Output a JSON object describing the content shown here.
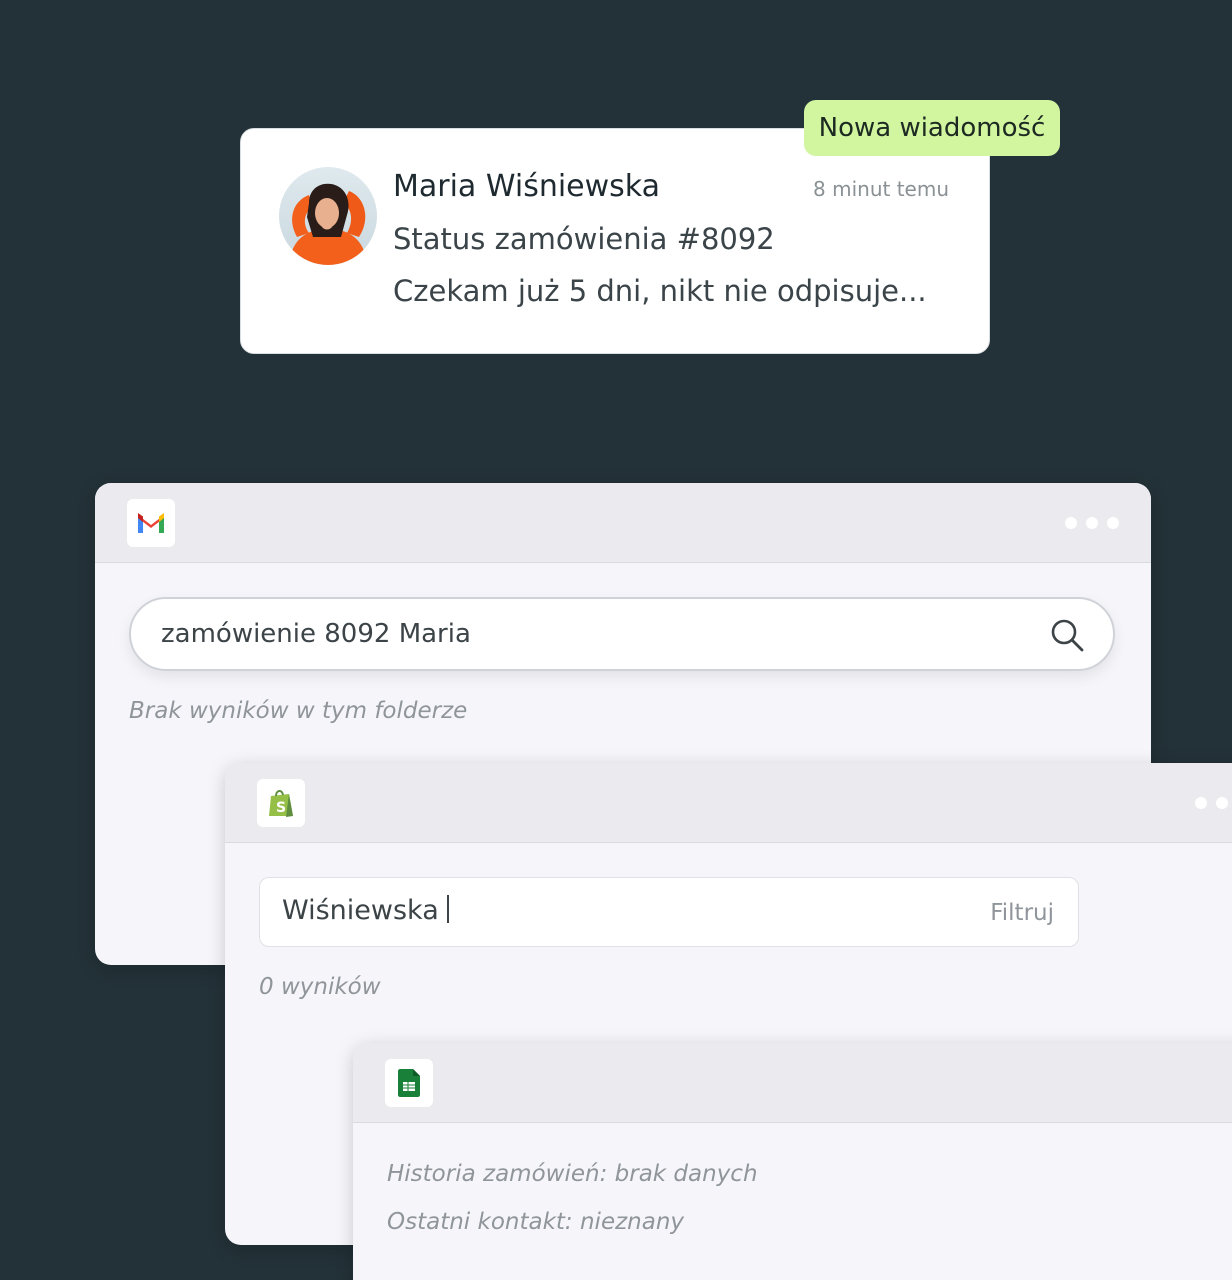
{
  "notification": {
    "badge": "Nowa wiadomość",
    "sender": "Maria Wiśniewska",
    "time": "8 minut temu",
    "subject": "Status zamówienia #8092",
    "preview": "Czekam już 5 dni, nikt nie odpisuje..."
  },
  "gmail": {
    "icon": "gmail-icon",
    "search_value": "zamówienie 8092 Maria",
    "no_results": "Brak wyników w tym folderze"
  },
  "shopify": {
    "icon": "shopify-icon",
    "filter_value": "Wiśniewska",
    "filter_button": "Filtruj",
    "results": "0 wyników"
  },
  "sheets": {
    "icon": "google-sheets-icon",
    "history": "Historia zamówień: brak danych",
    "last_contact": "Ostatni kontakt: nieznany"
  },
  "colors": {
    "background": "#233238",
    "badge": "#d2f5a0",
    "gmail_red": "#ea4335",
    "gmail_blue": "#4285f4",
    "gmail_green": "#34a853",
    "gmail_yellow": "#fbbc04",
    "shopify_green": "#95bf47",
    "sheets_green": "#188038"
  }
}
